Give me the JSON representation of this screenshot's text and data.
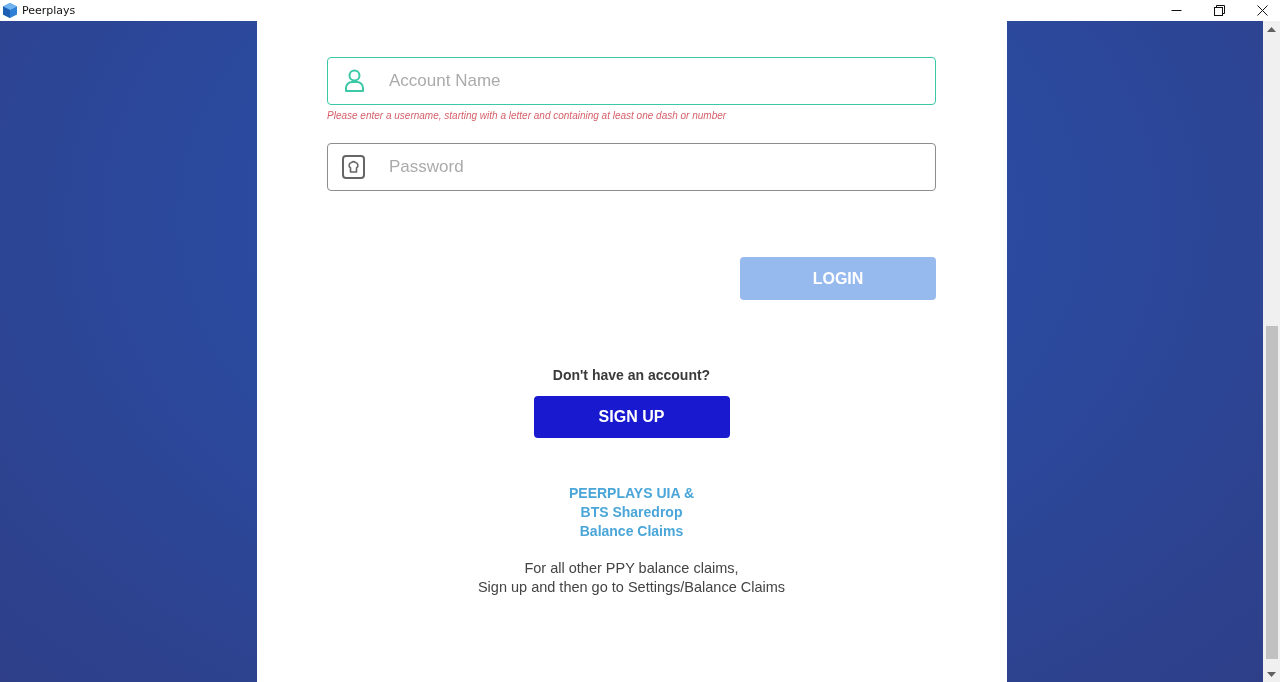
{
  "window": {
    "title": "Peerplays"
  },
  "login_form": {
    "account_field": {
      "placeholder": "Account Name",
      "focused": true,
      "error": "Please enter a username, starting with a letter and containing at least one dash or number"
    },
    "password_field": {
      "placeholder": "Password",
      "focused": false
    },
    "login_button": {
      "label": "LOGIN",
      "disabled": true
    }
  },
  "signup": {
    "prompt": "Don't have an account?",
    "button": "SIGN UP"
  },
  "balance_claims_link": [
    "PEERPLAYS UIA &",
    "BTS Sharedrop",
    "Balance Claims"
  ],
  "note": [
    "For all other PPY balance claims,",
    "Sign up and then go to Settings/Balance Claims"
  ]
}
